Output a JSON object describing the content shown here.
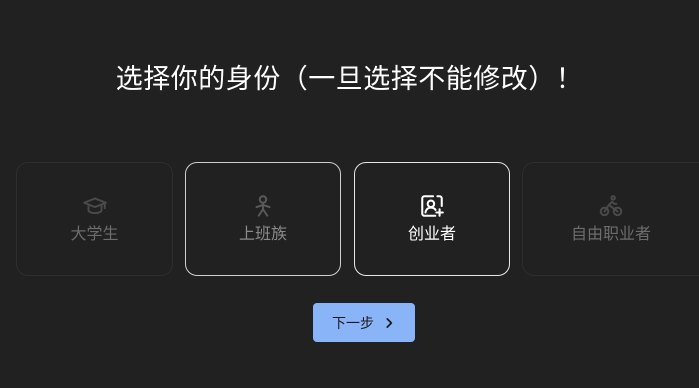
{
  "page": {
    "title": "选择你的身份（一旦选择不能修改）！"
  },
  "cards": [
    {
      "label": "大学生",
      "icon": "graduation-cap-icon"
    },
    {
      "label": "上班族",
      "icon": "person-office-icon"
    },
    {
      "label": "创业者",
      "icon": "startup-portrait-icon"
    },
    {
      "label": "自由职业者",
      "icon": "bicycle-icon"
    }
  ],
  "selected_card": "创业者",
  "next_button": {
    "label": "下一步",
    "icon": "chevron-right-icon"
  },
  "colors": {
    "background": "#212121",
    "accent": "#8ab4f8"
  }
}
